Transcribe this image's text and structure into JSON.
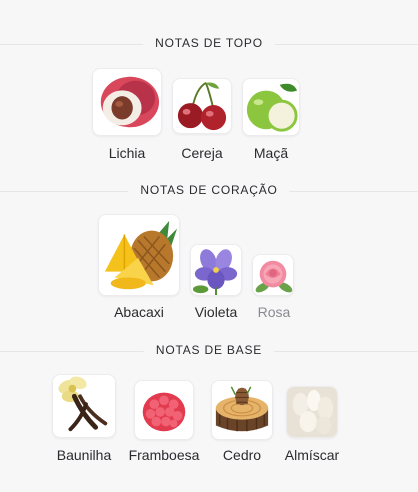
{
  "sections": [
    {
      "title": "NOTAS DE TOPO",
      "notes": [
        {
          "label": "Lichia",
          "icon": "lychee-icon"
        },
        {
          "label": "Cereja",
          "icon": "cherry-icon"
        },
        {
          "label": "Maçã",
          "icon": "apple-icon"
        }
      ]
    },
    {
      "title": "NOTAS DE CORAÇÃO",
      "notes": [
        {
          "label": "Abacaxi",
          "icon": "pineapple-icon"
        },
        {
          "label": "Violeta",
          "icon": "violet-icon"
        },
        {
          "label": "Rosa",
          "icon": "rose-icon"
        }
      ]
    },
    {
      "title": "NOTAS DE BASE",
      "notes": [
        {
          "label": "Baunilha",
          "icon": "vanilla-icon"
        },
        {
          "label": "Framboesa",
          "icon": "raspberry-icon"
        },
        {
          "label": "Cedro",
          "icon": "cedar-icon"
        },
        {
          "label": "Almíscar",
          "icon": "musk-icon"
        }
      ]
    }
  ],
  "colors": {
    "background": "#f7f7f8",
    "text": "#2b2b2f",
    "muted_text": "#8a8a90",
    "divider": "#e6e6ea"
  }
}
